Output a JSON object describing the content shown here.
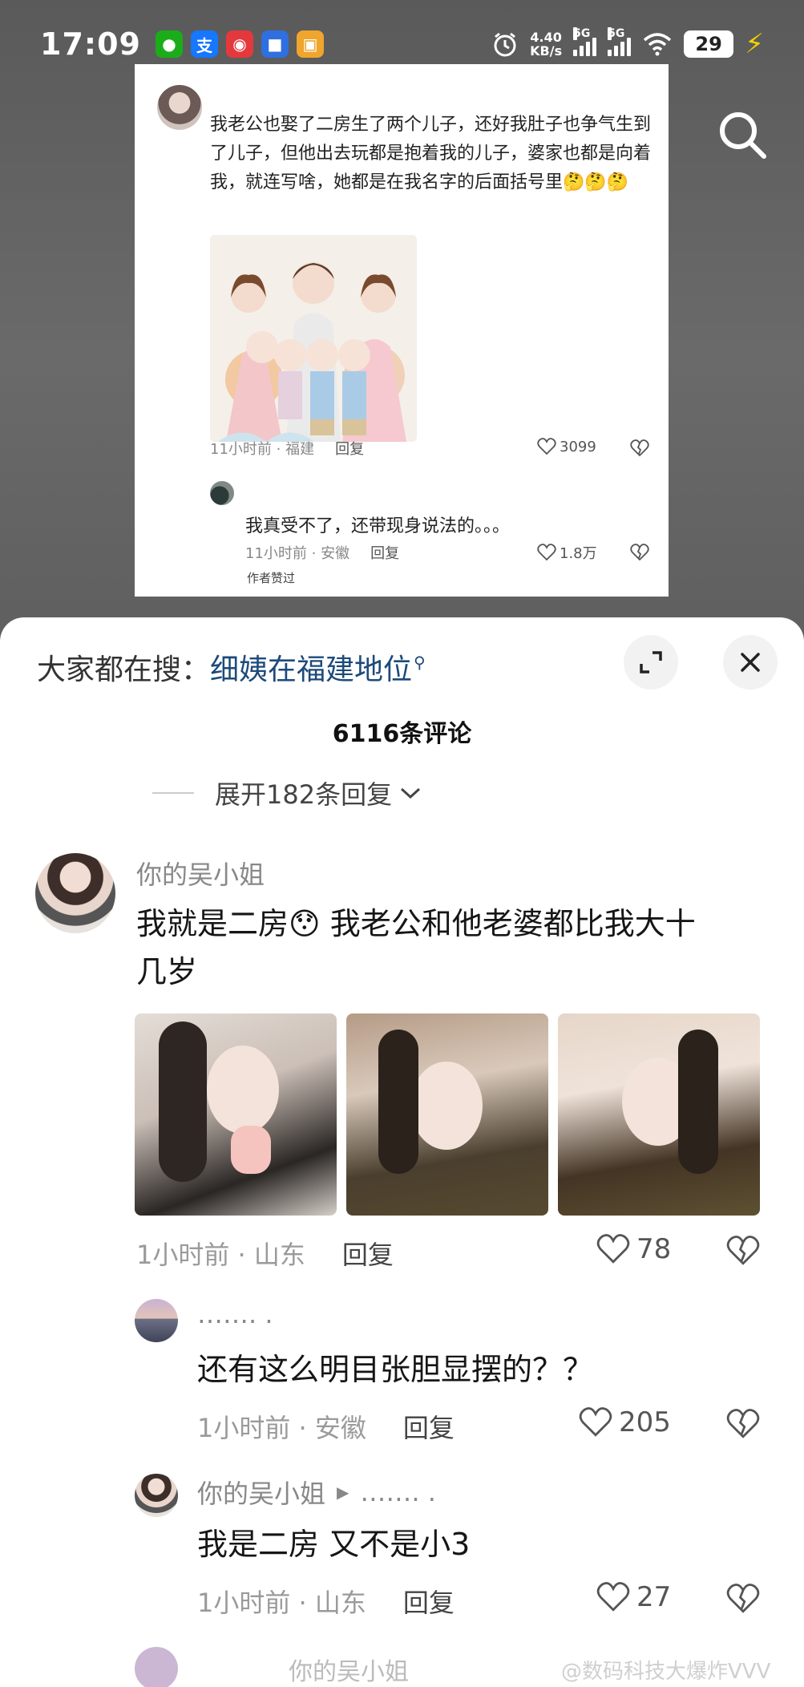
{
  "status_bar": {
    "time": "17:09",
    "apps": [
      {
        "icon": "wechat-icon",
        "glyph": "●",
        "color": "#1aad19"
      },
      {
        "icon": "alipay-icon",
        "glyph": "支",
        "color": "#1677ff"
      },
      {
        "icon": "app-red-icon",
        "glyph": "◉",
        "color": "#e4393c"
      },
      {
        "icon": "app-blue-icon",
        "glyph": "■",
        "color": "#2f6fe0"
      },
      {
        "icon": "app-orange-icon",
        "glyph": "▣",
        "color": "#f0a52c"
      }
    ],
    "net_speed": "4.40",
    "net_unit": "KB/s",
    "signal1": "5G",
    "signal2": "5G",
    "battery": "29"
  },
  "embedded_card": {
    "comment": "我老公也娶了二房生了两个儿子，还好我肚子也争气生到了儿子，但他出去玩都是抱着我的儿子，婆家也都是向着我，就连写啥，她都是在我名字的后面括号里🤔🤔🤔",
    "meta_time": "11小时前 · 福建",
    "reply": "回复",
    "likes": "3099",
    "sub_comment": "我真受不了，还带现身说法的。。。",
    "sub_meta_time": "11小时前 · 安徽",
    "sub_reply": "回复",
    "sub_likes": "1.8万",
    "author_liked": "作者赞过"
  },
  "sheet": {
    "search_label": "大家都在搜：",
    "search_term": "细姨在福建地位",
    "comment_count": "6116条评论",
    "expand_replies": "展开182条回复",
    "comments": [
      {
        "username": "你的吴小姐",
        "text_line1": "我就是二房😯 我老公和他老婆都比我大十",
        "text_line2": "几岁",
        "time": "1小时前 · 山东",
        "reply": "回复",
        "likes": "78"
      },
      {
        "username": "……. .",
        "text": "还有这么明目张胆显摆的？？",
        "time": "1小时前 · 安徽",
        "reply": "回复",
        "likes": "205"
      },
      {
        "username": "你的吴小姐",
        "reply_to": "……. .",
        "text": "我是二房 又不是小3",
        "time": "1小时前 · 山东",
        "reply": "回复",
        "likes": "27"
      }
    ],
    "next_username": "你的吴小姐",
    "watermark": "@数码科技大爆炸VVV"
  }
}
